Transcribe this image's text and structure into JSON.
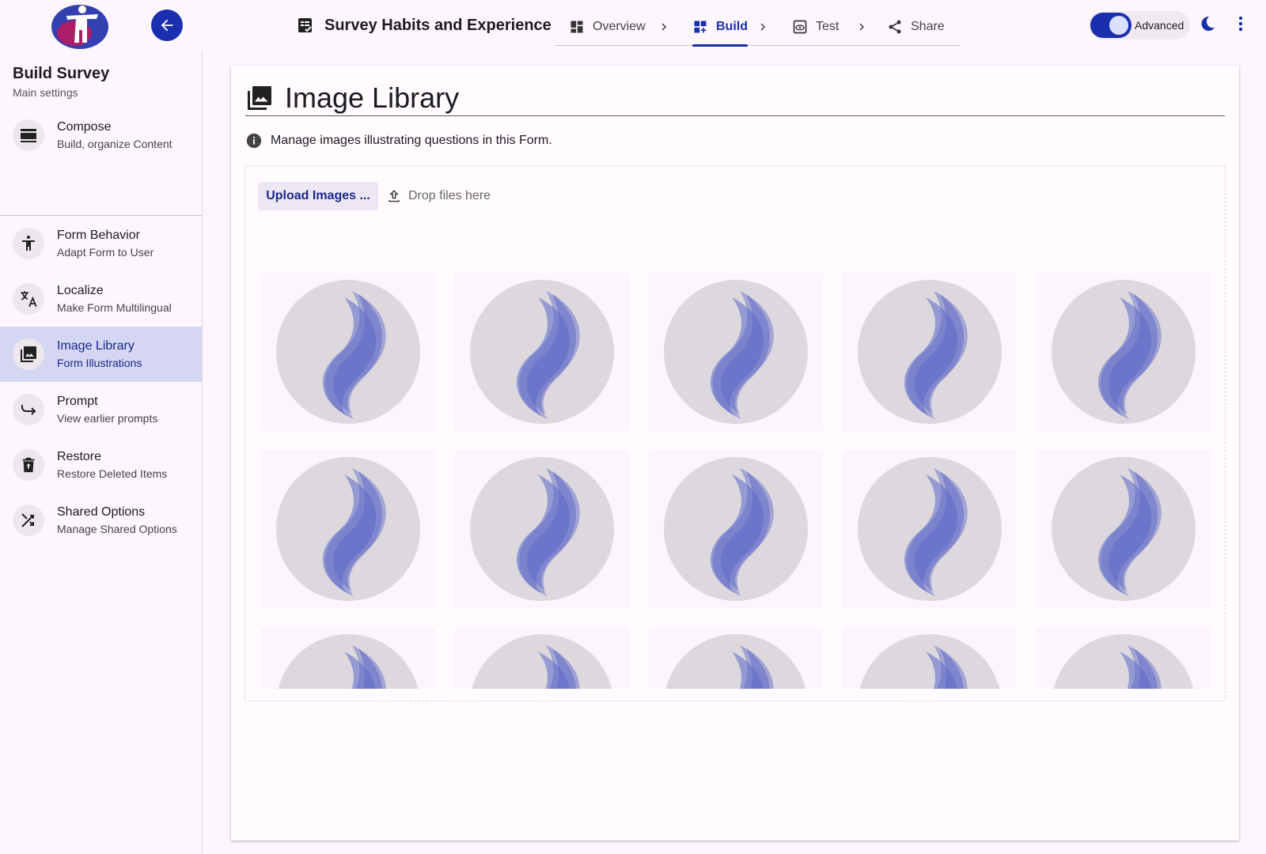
{
  "header": {
    "survey_title": "Survey Habits and Experience",
    "steps": [
      {
        "label": "Overview",
        "icon": "dashboard-icon",
        "active": false
      },
      {
        "label": "Build",
        "icon": "dashboard-add-icon",
        "active": true
      },
      {
        "label": "Test",
        "icon": "preview-eye-icon",
        "active": false
      },
      {
        "label": "Share",
        "icon": "share-icon",
        "active": false
      }
    ],
    "advanced_label": "Advanced",
    "advanced_on": true
  },
  "sidebar": {
    "title": "Build Survey",
    "subtitle": "Main settings",
    "items": [
      {
        "label": "Compose",
        "sub": "Build, organize Content",
        "icon": "compose-icon"
      },
      {
        "label": "Form Behavior",
        "sub": "Adapt Form to User",
        "icon": "accessibility-icon"
      },
      {
        "label": "Localize",
        "sub": "Make Form Multilingual",
        "icon": "translate-icon"
      },
      {
        "label": "Image Library",
        "sub": "Form Illustrations",
        "icon": "image-library-icon"
      },
      {
        "label": "Prompt",
        "sub": "View earlier prompts",
        "icon": "redo-arrow-icon"
      },
      {
        "label": "Restore",
        "sub": "Restore Deleted Items",
        "icon": "restore-trash-icon"
      },
      {
        "label": "Shared Options",
        "sub": "Manage Shared Options",
        "icon": "shuffle-icon"
      }
    ],
    "selected": "Image Library"
  },
  "main": {
    "title": "Image Library",
    "info_text": "Manage images illustrating questions in this Form.",
    "upload_label": "Upload Images ...",
    "drop_hint": "Drop files here",
    "image_count_visible": 15
  },
  "colors": {
    "accent": "#1a2fb0",
    "selected_bg": "#d4d6f2",
    "placeholder_circle": "#dcd8dd",
    "placeholder_wave": "#5b68c8"
  }
}
